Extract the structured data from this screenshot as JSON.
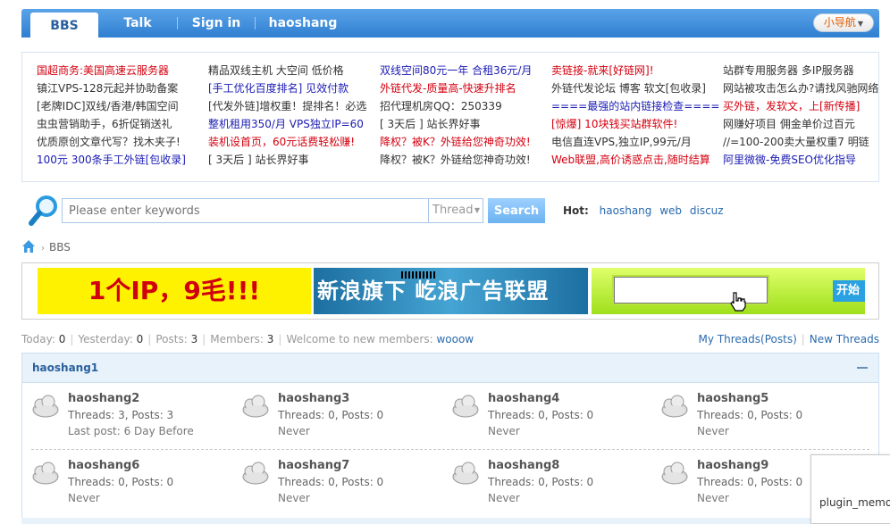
{
  "nav": {
    "tabs": [
      {
        "label": "BBS",
        "active": true
      },
      {
        "label": "Talk",
        "active": false
      },
      {
        "label": "Sign in",
        "active": false
      },
      {
        "label": "haoshang",
        "active": false
      }
    ],
    "quick_nav_label": "小导航"
  },
  "ad_columns": [
    [
      {
        "text": "国超商务:美国高速云服务器",
        "color": "#d4000f"
      },
      {
        "text": "镇江VPS-128元起并协助备案",
        "color": "#333333"
      },
      {
        "text": "[老牌IDC]双线/香港/韩国空间",
        "color": "#333333"
      },
      {
        "text": "虫虫营销助手，6折促销送礼",
        "color": "#333333"
      },
      {
        "text": "优质原创文章代写？找木夹子!",
        "color": "#333333"
      },
      {
        "text": "100元 300条手工外链[包收录]",
        "color": "#1b1bb4"
      }
    ],
    [
      {
        "text": "精品双线主机 大空间 低价格",
        "color": "#333333"
      },
      {
        "text": "[手工优化百度排名] 见效付款",
        "color": "#1b1bb4"
      },
      {
        "text": "[代发外链]增权重！提排名！必选",
        "color": "#333333"
      },
      {
        "text": "整机租用350/月 VPS独立IP=60",
        "color": "#1b1bb4"
      },
      {
        "text": "装机设首页，60元话费轻松赚!",
        "color": "#d4000f"
      },
      {
        "text": "[ 3天后 ] 站长界好事",
        "color": "#333333"
      }
    ],
    [
      {
        "text": "双线空间80元一年 合租36元/月",
        "color": "#1b1bb4"
      },
      {
        "text": "外链代发-质量高-快速升排名",
        "color": "#d4000f"
      },
      {
        "text": "招代理机房QQ：250339",
        "color": "#333333"
      },
      {
        "text": "[ 3天后 ] 站长界好事",
        "color": "#333333"
      },
      {
        "text": "降权？被K？外链给您神奇功效!",
        "color": "#d4000f"
      },
      {
        "text": "降权？被K？外链给您神奇功效!",
        "color": "#333333"
      }
    ],
    [
      {
        "text": "卖链接-就来[好链网]!",
        "color": "#d4000f"
      },
      {
        "text": "外链代发论坛 博客 软文[包收录]",
        "color": "#333333"
      },
      {
        "text": "====最强的站内链接检查====",
        "color": "#1b1bb4"
      },
      {
        "text": "[惊爆] 10块钱买站群软件!",
        "color": "#d4000f"
      },
      {
        "text": "电信直连VPS,独立IP,99元/月",
        "color": "#333333"
      },
      {
        "text": "Web联盟,高价诱惑点击,随时结算",
        "color": "#d4000f"
      }
    ],
    [
      {
        "text": "站群专用服务器 多IP服务器",
        "color": "#333333"
      },
      {
        "text": "网站被攻击怎么办?请找风驰网络",
        "color": "#333333"
      },
      {
        "text": "买外链，发软文，上[新传播]",
        "color": "#d4000f"
      },
      {
        "text": "网赚好项目 佣金单价过百元",
        "color": "#333333"
      },
      {
        "text": "//=100-200卖大量权重7 明链",
        "color": "#333333"
      },
      {
        "text": "阿里微微-免费SEO优化指导",
        "color": "#1b1bb4"
      }
    ]
  ],
  "search": {
    "placeholder": "Please enter keywords",
    "type_label": "Thread",
    "button_label": "Search",
    "hot_label": "Hot:",
    "hot_words": [
      "haoshang",
      "web",
      "discuz"
    ]
  },
  "breadcrumb": {
    "current": "BBS"
  },
  "banners": {
    "banner1_text": "1个IP，9毛!!!",
    "banner2_text": "新浪旗下 屹浪广告联盟",
    "banner3_button": "开始"
  },
  "stats": {
    "today_label": "Today:",
    "today": "0",
    "yesterday_label": "Yesterday:",
    "yesterday": "0",
    "posts_label": "Posts:",
    "posts": "3",
    "members_label": "Members:",
    "members": "3",
    "welcome_label": "Welcome to new members:",
    "new_member": "wooow",
    "my_threads": "My Threads(Posts)",
    "new_threads": "New Threads"
  },
  "group": {
    "title": "haoshang1",
    "forums": [
      {
        "name": "haoshang2",
        "stats": "Threads: 3, Posts: 3",
        "last": "Last post: 6 Day Before"
      },
      {
        "name": "haoshang3",
        "stats": "Threads: 0, Posts: 0",
        "last": "Never"
      },
      {
        "name": "haoshang4",
        "stats": "Threads: 0, Posts: 0",
        "last": "Never"
      },
      {
        "name": "haoshang5",
        "stats": "Threads: 0, Posts: 0",
        "last": "Never"
      },
      {
        "name": "haoshang6",
        "stats": "Threads: 0, Posts: 0",
        "last": "Never"
      },
      {
        "name": "haoshang7",
        "stats": "Threads: 0, Posts: 0",
        "last": "Never"
      },
      {
        "name": "haoshang8",
        "stats": "Threads: 0, Posts: 0",
        "last": "Never"
      },
      {
        "name": "haoshang9",
        "stats": "Threads: 0, Posts: 0",
        "last": "Never"
      }
    ]
  },
  "plugin_memo": {
    "label": "plugin_memo"
  }
}
